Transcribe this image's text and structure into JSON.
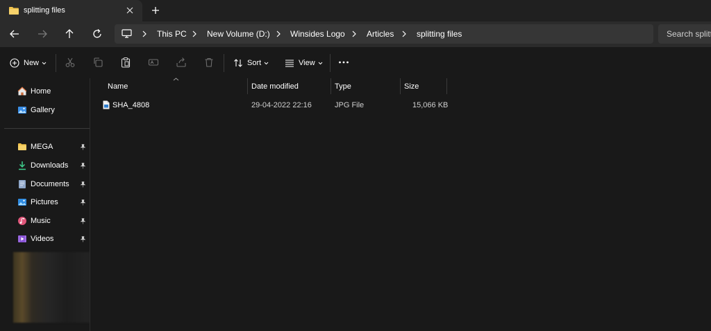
{
  "tab": {
    "title": "splitting files",
    "folder_icon": "folder-icon",
    "close_icon": "close-icon",
    "add_icon": "plus-icon"
  },
  "nav": {
    "back": "back-arrow-icon",
    "forward": "forward-arrow-icon",
    "up": "up-arrow-icon",
    "refresh": "refresh-icon"
  },
  "breadcrumb": {
    "root_icon": "this-pc-icon",
    "items": [
      "This PC",
      "New Volume (D:)",
      "Winsides Logo",
      "Articles",
      "splitting files"
    ]
  },
  "search": {
    "placeholder": "Search splitting files"
  },
  "toolbar": {
    "new_label": "New",
    "sort_label": "Sort",
    "view_label": "View",
    "icons": [
      "cut-icon",
      "copy-icon",
      "paste-icon",
      "rename-icon",
      "share-icon",
      "delete-icon",
      "more-icon"
    ]
  },
  "sidebar": {
    "top_items": [
      {
        "label": "Home",
        "icon": "home-icon"
      },
      {
        "label": "Gallery",
        "icon": "gallery-icon"
      }
    ],
    "quick_access": [
      {
        "label": "MEGA",
        "icon": "folder-icon",
        "pinned": true
      },
      {
        "label": "Downloads",
        "icon": "download-icon",
        "pinned": true
      },
      {
        "label": "Documents",
        "icon": "documents-icon",
        "pinned": true
      },
      {
        "label": "Pictures",
        "icon": "pictures-icon",
        "pinned": true
      },
      {
        "label": "Music",
        "icon": "music-icon",
        "pinned": true
      },
      {
        "label": "Videos",
        "icon": "videos-icon",
        "pinned": true
      }
    ]
  },
  "columns": {
    "name": "Name",
    "date_modified": "Date modified",
    "type": "Type",
    "size": "Size"
  },
  "files": [
    {
      "name": "SHA_4808",
      "date_modified": "29-04-2022 22:16",
      "type": "JPG File",
      "size": "15,066 KB",
      "icon": "image-file-icon"
    }
  ],
  "colors": {
    "accent": "#60cdff",
    "folder": "#f0c24b",
    "background": "#191919",
    "chrome": "#2b2b2b"
  }
}
